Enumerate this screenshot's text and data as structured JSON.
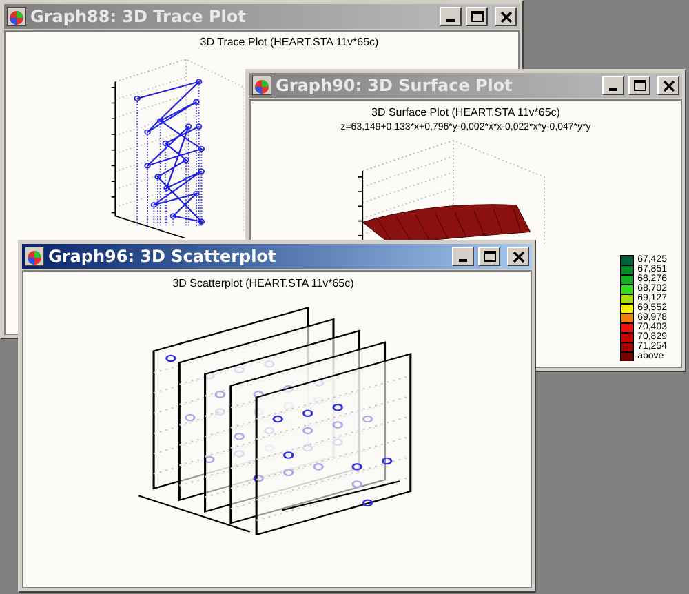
{
  "windows": [
    {
      "kind": "trace",
      "title": "Graph88: 3D Trace Plot",
      "active": false,
      "chart_title": "3D Trace Plot (HEART.STA 11v*65c)"
    },
    {
      "kind": "surface",
      "title": "Graph90: 3D Surface Plot",
      "active": false,
      "chart_title": "3D Surface Plot (HEART.STA 11v*65c)",
      "formula": "z=63,149+0,133*x+0,796*y-0,002*x*x-0,022*x*y-0,047*y*y",
      "legend": [
        {
          "label": "67,425",
          "color": "#00603a"
        },
        {
          "label": "67,851",
          "color": "#008a2a"
        },
        {
          "label": "68,276",
          "color": "#10b020"
        },
        {
          "label": "68,702",
          "color": "#30e020"
        },
        {
          "label": "69,127",
          "color": "#a8e000"
        },
        {
          "label": "69,552",
          "color": "#f8f000"
        },
        {
          "label": "69,978",
          "color": "#f08000"
        },
        {
          "label": "70,403",
          "color": "#f01010"
        },
        {
          "label": "70,829",
          "color": "#c80000"
        },
        {
          "label": "71,254",
          "color": "#a00000"
        },
        {
          "label": "above",
          "color": "#780000"
        }
      ]
    },
    {
      "kind": "scatter",
      "title": "Graph96: 3D Scatterplot",
      "active": true,
      "chart_title": "3D Scatterplot (HEART.STA 11v*65c)"
    }
  ]
}
